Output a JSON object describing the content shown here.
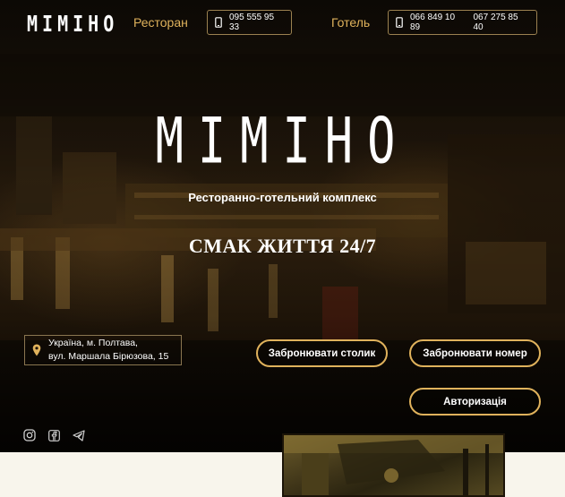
{
  "header": {
    "logo": "MIMIHO",
    "nav": [
      {
        "label": "Ресторан",
        "phones": [
          "095 555 95 33"
        ]
      },
      {
        "label": "Готель",
        "phones": [
          "066 849 10 89",
          "067 275 85 40"
        ]
      }
    ]
  },
  "hero": {
    "logo": "MIMIHO",
    "subtitle": "Ресторанно-готельний комплекс",
    "slogan": "СМАК ЖИТТЯ 24/7"
  },
  "address": {
    "line1": "Україна, м. Полтава,",
    "line2": "вул. Маршала Бірюзова, 15"
  },
  "buttons": {
    "book_table": "Забронювати столик",
    "book_room": "Забронювати номер",
    "login": "Авторизація"
  },
  "socials": [
    {
      "icon": "instagram-icon"
    },
    {
      "icon": "facebook-icon"
    },
    {
      "icon": "telegram-icon"
    }
  ],
  "colors": {
    "accent": "#e0b25c",
    "bottom_background": "#f8f5ec"
  }
}
